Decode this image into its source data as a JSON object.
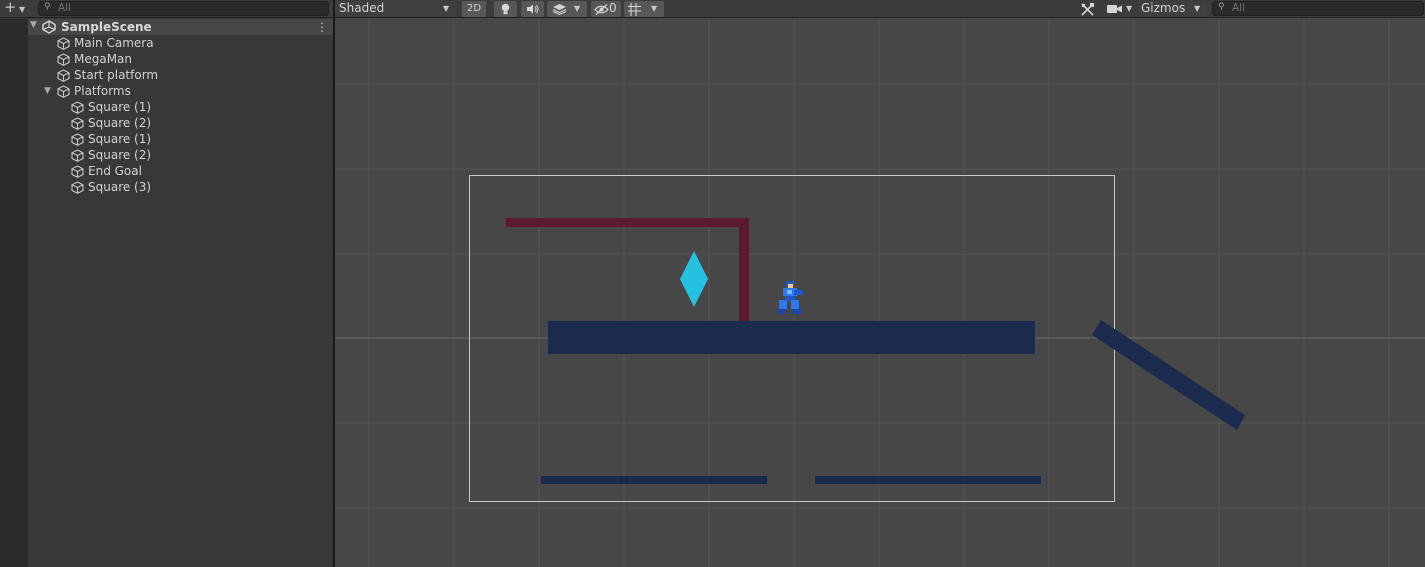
{
  "hierarchy": {
    "search_placeholder": "All",
    "scene_name": "SampleScene",
    "items": [
      {
        "label": "Main Camera"
      },
      {
        "label": "MegaMan"
      },
      {
        "label": "Start platform"
      },
      {
        "label": "Platforms"
      }
    ],
    "platform_children": [
      {
        "label": "Square (1)"
      },
      {
        "label": "Square (2)"
      },
      {
        "label": "Square (1)"
      },
      {
        "label": "Square (2)"
      },
      {
        "label": "End Goal"
      },
      {
        "label": "Square (3)"
      }
    ]
  },
  "scene_toolbar": {
    "shading_mode": "Shaded",
    "mode_2d_label": "2D",
    "hidden_count": "0",
    "gizmos_label": "Gizmos",
    "search_placeholder": "All"
  },
  "icons": {
    "add": "plus-icon",
    "search": "search-icon",
    "scene": "unity-scene-icon",
    "gameobject": "cube-icon",
    "lighting": "light-bulb-icon",
    "audio": "speaker-icon",
    "effects": "layers-icon",
    "hidden": "eye-slash-icon",
    "grid": "grid-snap-icon",
    "tools": "tools-icon",
    "camera": "camera-icon"
  },
  "colors": {
    "editor_bg": "#383838",
    "scene_bg": "#474747",
    "platform": "#1b2b4d",
    "wall": "#5c1a2e",
    "goal": "#24c2e0",
    "camera_frame": "#c8c8c8"
  }
}
